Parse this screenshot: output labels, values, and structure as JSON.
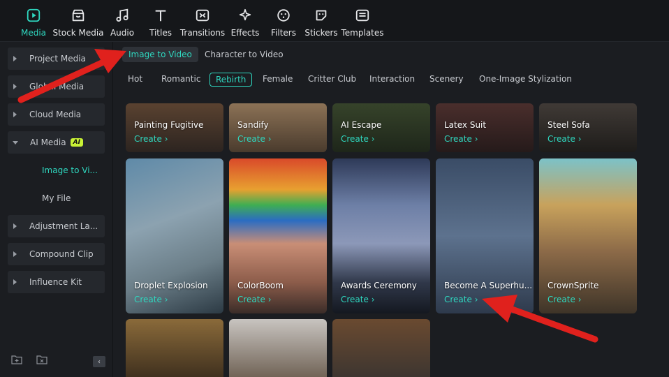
{
  "toolbar": {
    "items": [
      {
        "label": "Media",
        "icon": "media-icon",
        "active": true
      },
      {
        "label": "Stock Media",
        "icon": "stock-media-icon"
      },
      {
        "label": "Audio",
        "icon": "music-note-icon"
      },
      {
        "label": "Titles",
        "icon": "title-t-icon"
      },
      {
        "label": "Transitions",
        "icon": "transitions-icon"
      },
      {
        "label": "Effects",
        "icon": "effects-sparkle-icon"
      },
      {
        "label": "Filters",
        "icon": "filters-icon"
      },
      {
        "label": "Stickers",
        "icon": "stickers-icon"
      },
      {
        "label": "Templates",
        "icon": "templates-icon"
      }
    ]
  },
  "sidebar": {
    "items": [
      {
        "label": "Project Media"
      },
      {
        "label": "Global Media"
      },
      {
        "label": "Cloud Media"
      },
      {
        "label": "AI Media",
        "badge": "AI",
        "open": true
      },
      {
        "label": "Adjustment La..."
      },
      {
        "label": "Compound Clip"
      },
      {
        "label": "Influence Kit"
      }
    ],
    "sub_items": [
      {
        "label": "Image to Vi...",
        "active": true
      },
      {
        "label": "My File"
      }
    ]
  },
  "main": {
    "mode_tabs": [
      {
        "label": "Image to Video",
        "active": true
      },
      {
        "label": "Character to Video"
      }
    ],
    "categories": [
      {
        "label": "Hot"
      },
      {
        "label": "Romantic"
      },
      {
        "label": "Rebirth",
        "active": true
      },
      {
        "label": "Female"
      },
      {
        "label": "Critter Club"
      },
      {
        "label": "Interaction"
      },
      {
        "label": "Scenery"
      },
      {
        "label": "One-Image Stylization"
      }
    ],
    "create_label": "Create",
    "cards_row1": [
      {
        "title": "Painting Fugitive"
      },
      {
        "title": "Sandify"
      },
      {
        "title": "AI Escape"
      },
      {
        "title": "Latex Suit"
      },
      {
        "title": "Steel Sofa"
      }
    ],
    "cards_row2": [
      {
        "title": "Droplet Explosion"
      },
      {
        "title": "ColorBoom"
      },
      {
        "title": "Awards Ceremony"
      },
      {
        "title": "Become A Superhu..."
      },
      {
        "title": "CrownSprite"
      }
    ]
  },
  "colors": {
    "accent": "#2fd8c0",
    "annotation_arrow": "#e0211d",
    "ai_badge": "#c9f235"
  }
}
